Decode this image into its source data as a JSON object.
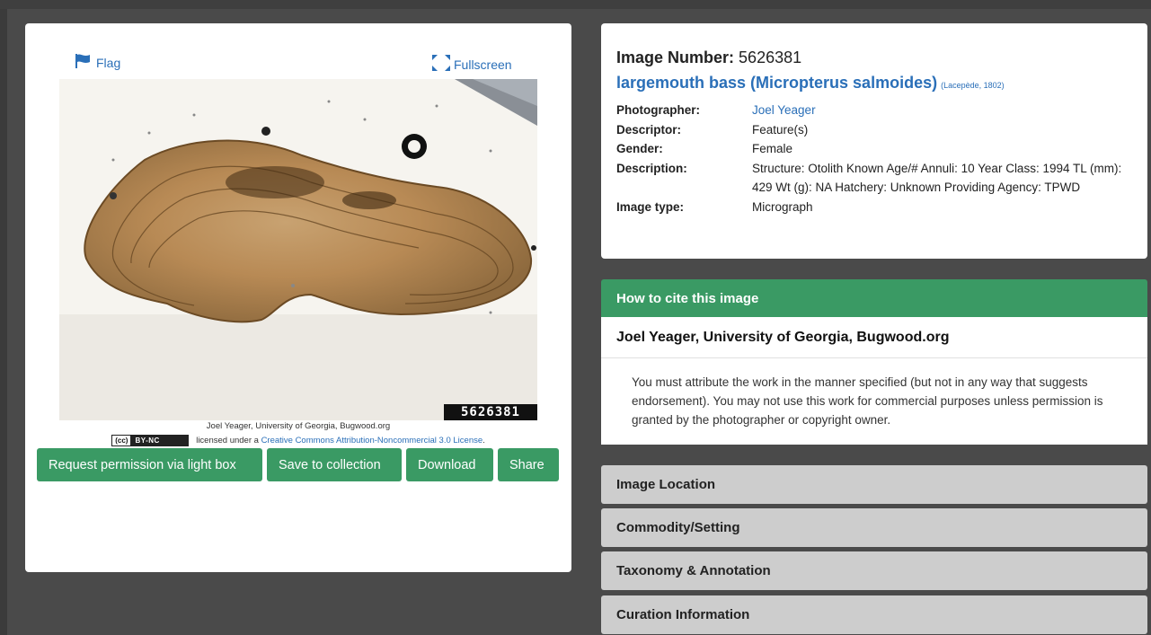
{
  "viewer": {
    "flag_label": "Flag",
    "fullscreen_label": "Fullscreen",
    "image_number_overlay": "5626381",
    "photo_credit": "Joel Yeager, University of Georgia, Bugwood.org",
    "license_prefix": "licensed under a",
    "license_link": "Creative Commons Attribution-Noncommercial 3.0 License",
    "license_suffix": ".",
    "cc_badge_cc": "(cc)",
    "cc_badge_text": "BY-NC",
    "buttons": {
      "request": "Request permission via light box",
      "save": "Save to collection",
      "download": "Download",
      "share": "Share"
    }
  },
  "info": {
    "image_number_label": "Image Number:",
    "image_number_value": "5626381",
    "species": "largemouth bass (Micropterus salmoides)",
    "authority": "(Lacepède, 1802)",
    "fields": [
      {
        "label": "Photographer:",
        "value": "Joel Yeager"
      },
      {
        "label": "Descriptor:",
        "value": "Feature(s)"
      },
      {
        "label": "Gender:",
        "value": "Female"
      },
      {
        "label": "Description:",
        "value": "Structure: Otolith Known Age/# Annuli: 10 Year Class: 1994 TL (mm): 429 Wt (g): NA Hatchery: Unknown Providing Agency: TPWD"
      },
      {
        "label": "Image type:",
        "value": "Micrograph"
      }
    ]
  },
  "cite": {
    "heading": "How to cite this image",
    "name": "Joel Yeager, University of Georgia, Bugwood.org",
    "note": "You must attribute the work in the manner specified (but not in any way that suggests endorsement). You may not use this work for commercial purposes unless permission is granted by the photographer or copyright owner."
  },
  "accordion": {
    "location": "Image Location",
    "commodity": "Commodity/Setting",
    "taxonomy": "Taxonomy & Annotation",
    "curation": "Curation Information"
  },
  "colors": {
    "accent_green": "#3a9a64",
    "link_blue": "#2a6fb8",
    "accordion_gray": "#cdcdcd",
    "background": "#4a4a4a"
  }
}
